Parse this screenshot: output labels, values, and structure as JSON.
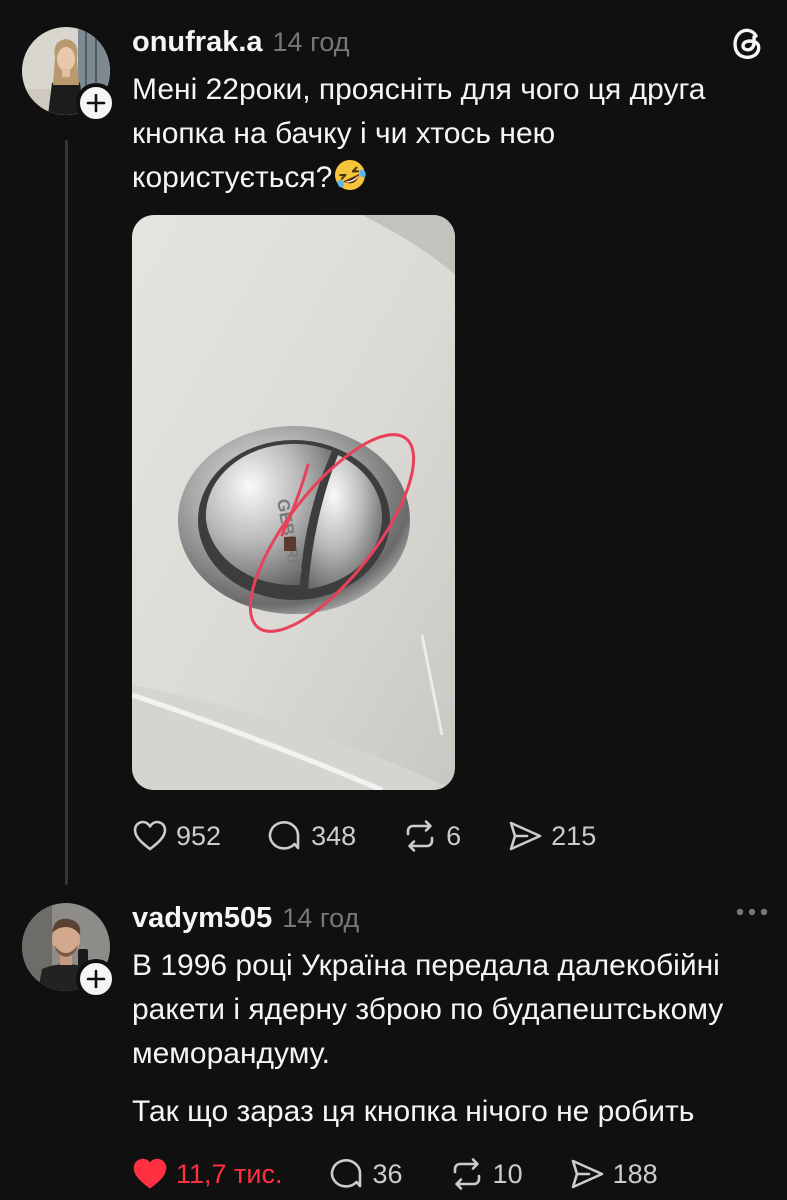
{
  "post1": {
    "username": "onufrak.a",
    "time": "14 год",
    "text_line1": "Мені 22роки, проясніть для чого ця друга",
    "text_line2": "кнопка на бачку і чи хтось нею",
    "text_line3": "користується?",
    "emoji": "rolling-on-floor-laughing",
    "image_alt": "chrome dual flush button on white toilet tank with red circle around second button",
    "image_embossed_text": "GEBERIT",
    "likes": "952",
    "replies": "348",
    "reposts": "6",
    "shares": "215"
  },
  "post2": {
    "username": "vadym505",
    "time": "14 год",
    "text_line1": "В 1996 році Україна передала далекобійні",
    "text_line2": "ракети і ядерну зброю по будапештському",
    "text_line3": "меморандуму.",
    "text_line4": "Так що зараз ця кнопка нічого не робить",
    "likes": "11,7 тис.",
    "liked": true,
    "replies": "36",
    "reposts": "10",
    "shares": "188"
  },
  "colors": {
    "background": "#101010",
    "text": "#f3f5f7",
    "muted": "#777777",
    "like_active": "#ff3040"
  },
  "icons": [
    "threads-logo-icon",
    "heart-icon",
    "comment-icon",
    "repost-icon",
    "share-icon",
    "more-icon",
    "follow-plus-icon"
  ]
}
